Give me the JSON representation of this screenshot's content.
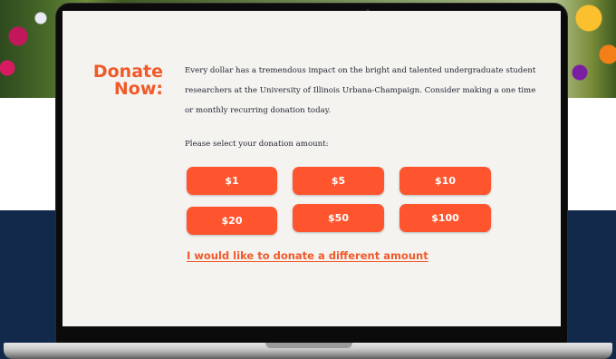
{
  "donate": {
    "heading_line1": "Donate",
    "heading_line2": "Now:",
    "intro_text": "Every dollar has a tremendous impact on the bright and talented undergraduate student researchers at the University of Illinois Urbana-Champaign. Consider making a one time or monthly recurring donation today.",
    "select_label": "Please select your donation amount:",
    "amounts": [
      "$1",
      "$5",
      "$10",
      "$20",
      "$50",
      "$100"
    ],
    "other_amount_link": "I would like to donate a different amount"
  },
  "colors": {
    "accent": "#ff552e",
    "heading": "#f05a2a",
    "navy": "#13294b",
    "screen_bg": "#f5f3f0"
  }
}
